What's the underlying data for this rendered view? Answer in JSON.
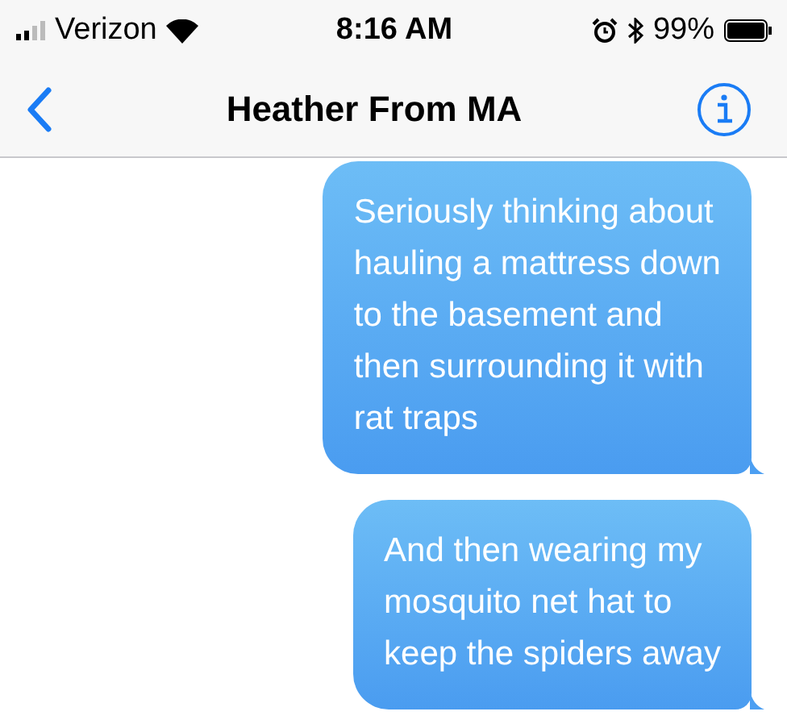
{
  "status_bar": {
    "carrier": "Verizon",
    "time": "8:16 AM",
    "battery": "99%"
  },
  "header": {
    "title": "Heather From MA"
  },
  "messages": [
    {
      "kind": "sent",
      "text": "Seriously thinking about\nhauling a mattress down\nto the basement and\nthen surrounding it with\nrat traps"
    },
    {
      "kind": "sent",
      "text": "And then wearing my\nmosquito net hat to\nkeep the spiders away"
    }
  ]
}
